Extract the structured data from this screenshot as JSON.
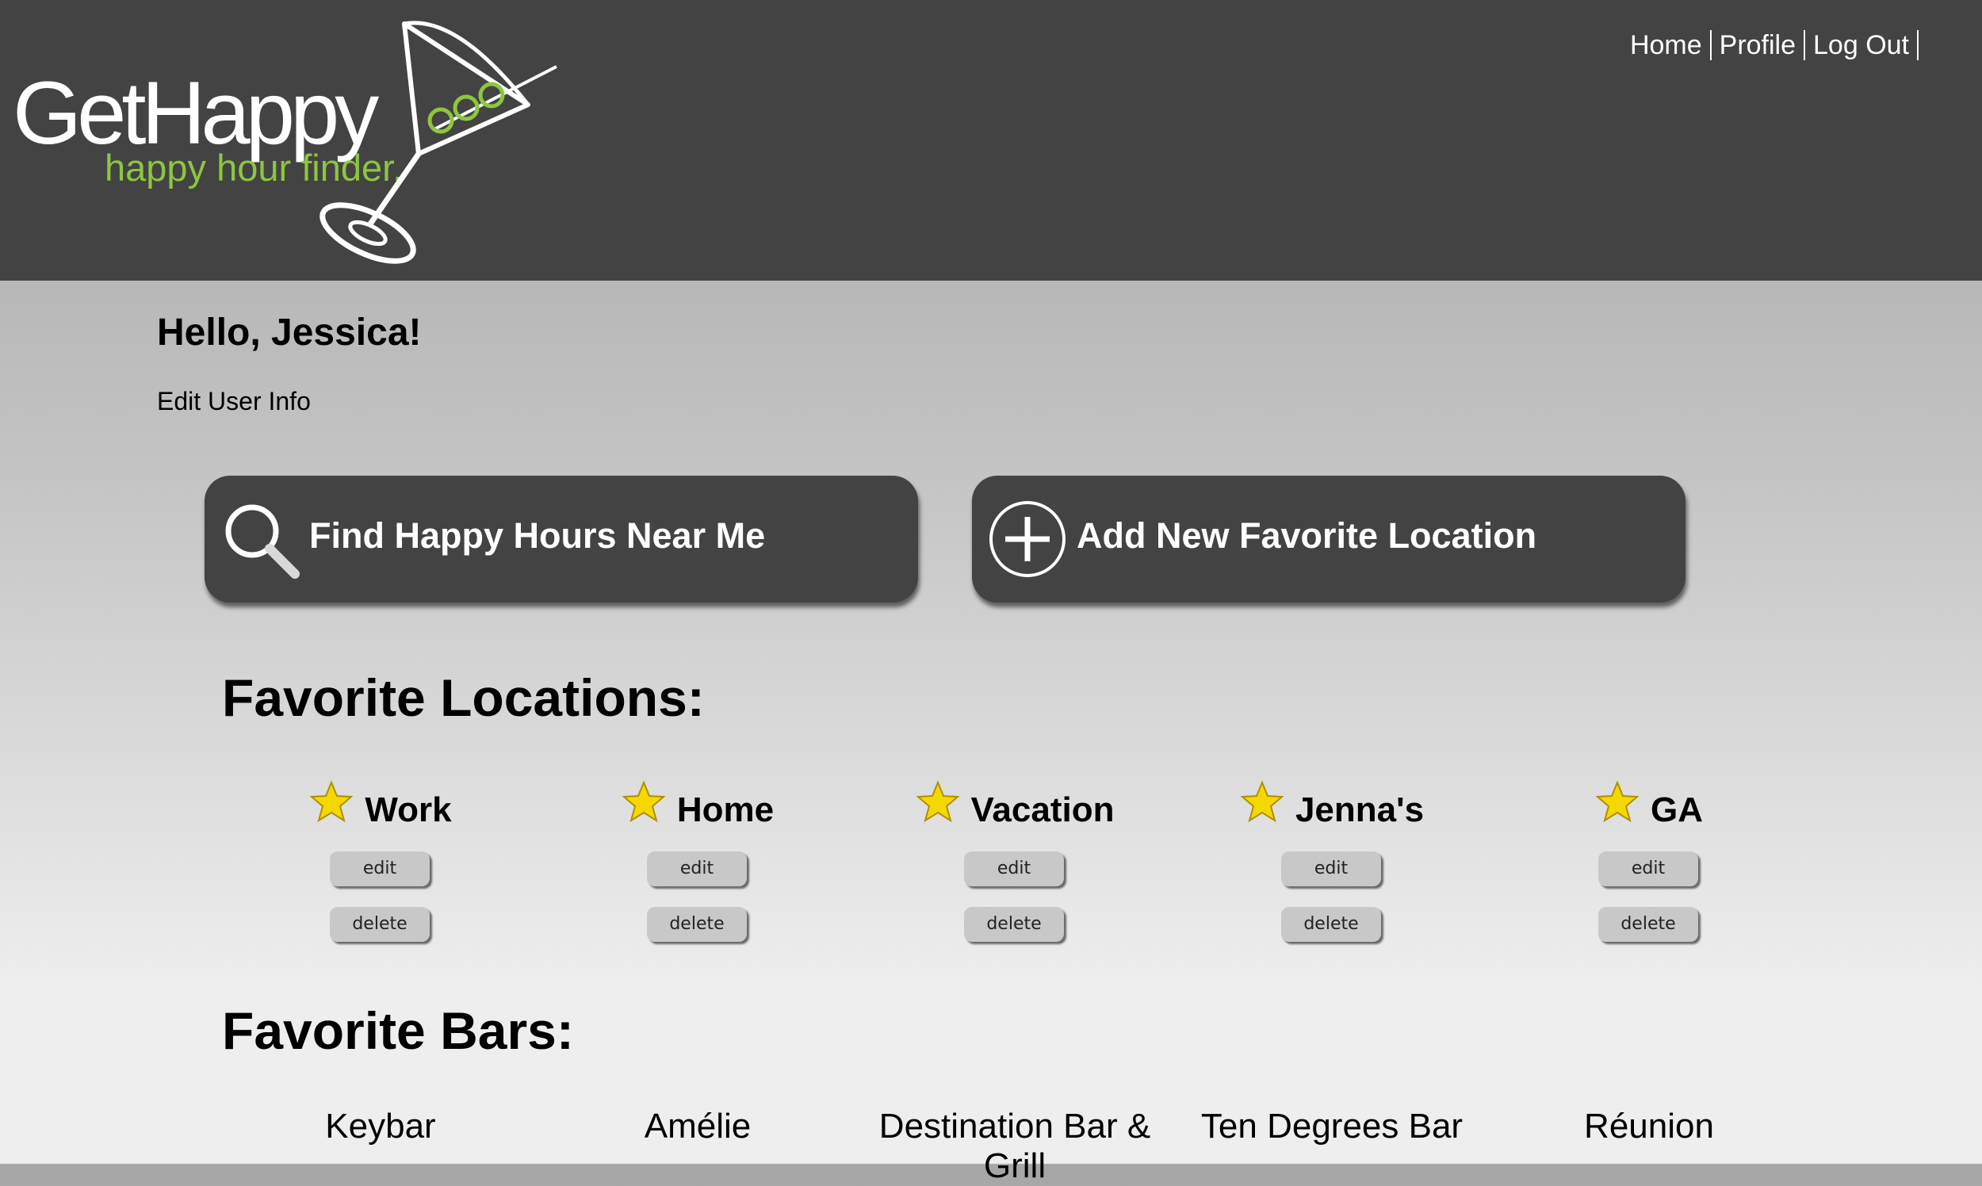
{
  "header": {
    "logo": {
      "brand": "GetHappy",
      "tagline": "happy hour finder.",
      "icon": "martini-glass-icon",
      "colors": {
        "brand": "#ffffff",
        "tagline": "#8dc63f",
        "olive": "#8dc63f"
      }
    },
    "nav": {
      "home": "Home",
      "profile": "Profile",
      "logout": "Log Out"
    },
    "background": "#434343"
  },
  "main": {
    "greeting": "Hello, Jessica!",
    "edit_user": "Edit User Info",
    "actions": {
      "find_label": "Find Happy Hours Near Me",
      "find_icon": "magnifier-icon",
      "add_label": "Add New Favorite Location",
      "add_icon": "plus-circle-icon"
    },
    "favorite_locations": {
      "title": "Favorite Locations:",
      "star_icon": "star-icon",
      "star_color": "#f5d800",
      "edit_label": "edit",
      "delete_label": "delete",
      "items": [
        {
          "name": "Work"
        },
        {
          "name": "Home"
        },
        {
          "name": "Vacation"
        },
        {
          "name": "Jenna's"
        },
        {
          "name": "GA"
        }
      ]
    },
    "favorite_bars": {
      "title": "Favorite Bars:",
      "items": [
        {
          "name": "Keybar"
        },
        {
          "name": "Amélie"
        },
        {
          "name": "Destination Bar & Grill"
        },
        {
          "name": "Ten Degrees Bar"
        },
        {
          "name": "Réunion"
        }
      ]
    }
  }
}
